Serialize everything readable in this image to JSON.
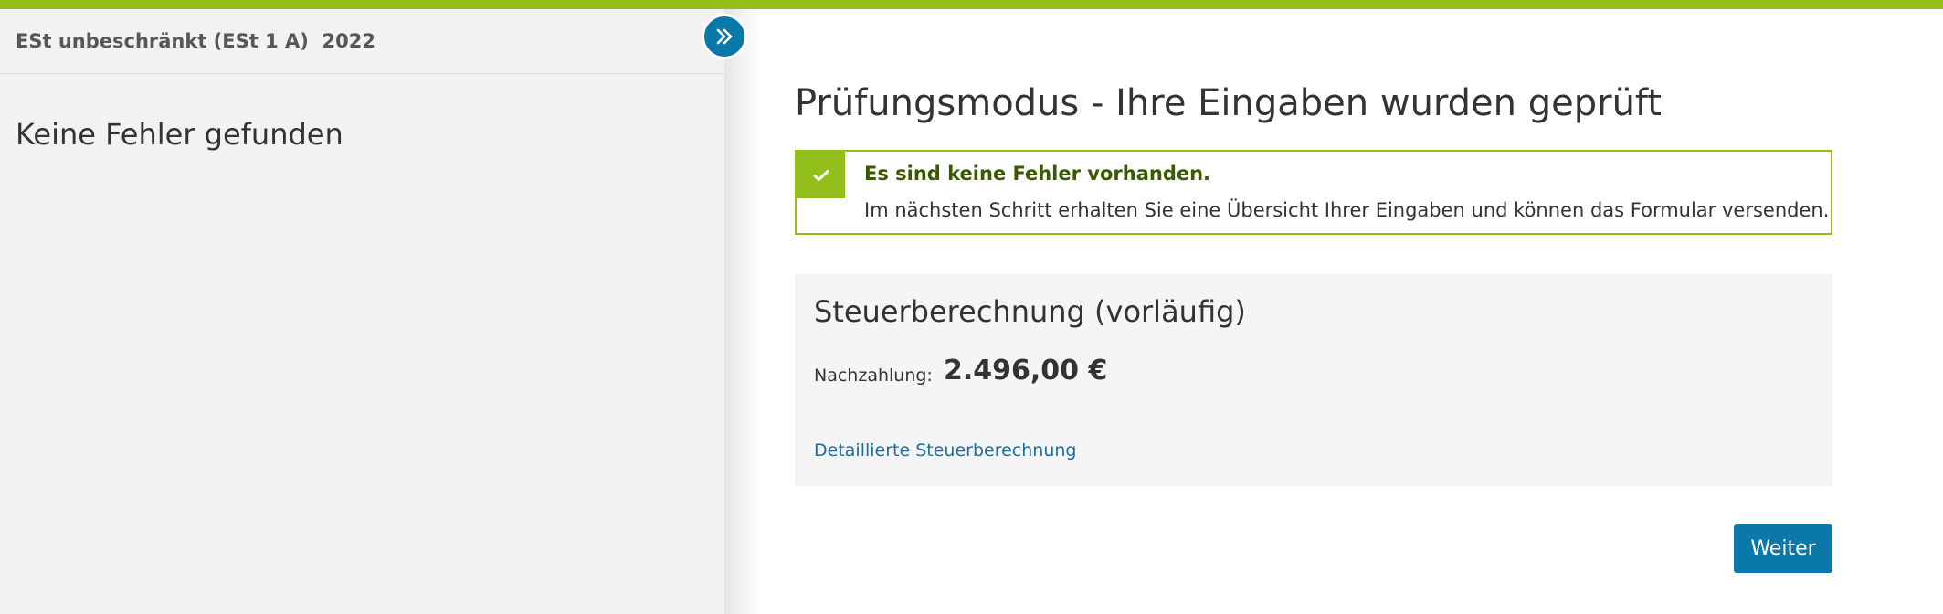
{
  "sidebar": {
    "title": "ESt unbeschränkt (ESt 1 A)  2022",
    "message": "Keine Fehler gefunden",
    "toggle_icon": "double-chevron-right-icon"
  },
  "main": {
    "title": "Prüfungsmodus - Ihre Eingaben wurden geprüft",
    "success": {
      "icon": "check-icon",
      "title": "Es sind keine Fehler vorhanden.",
      "text": "Im nächsten Schritt erhalten Sie eine Übersicht Ihrer Eingaben und können das Formular versenden."
    },
    "calculation": {
      "title": "Steuerberechnung (vorläufig)",
      "label": "Nachzahlung:",
      "amount": "2.496,00 €",
      "link": "Detaillierte Steuerberechnung"
    },
    "next_label": "Weiter"
  },
  "colors": {
    "accent_green": "#93bf1a",
    "primary_blue": "#0a78a8",
    "success_title": "#3b5a00",
    "link_blue": "#1a6f9e",
    "sidebar_bg": "#f2f2f2"
  }
}
